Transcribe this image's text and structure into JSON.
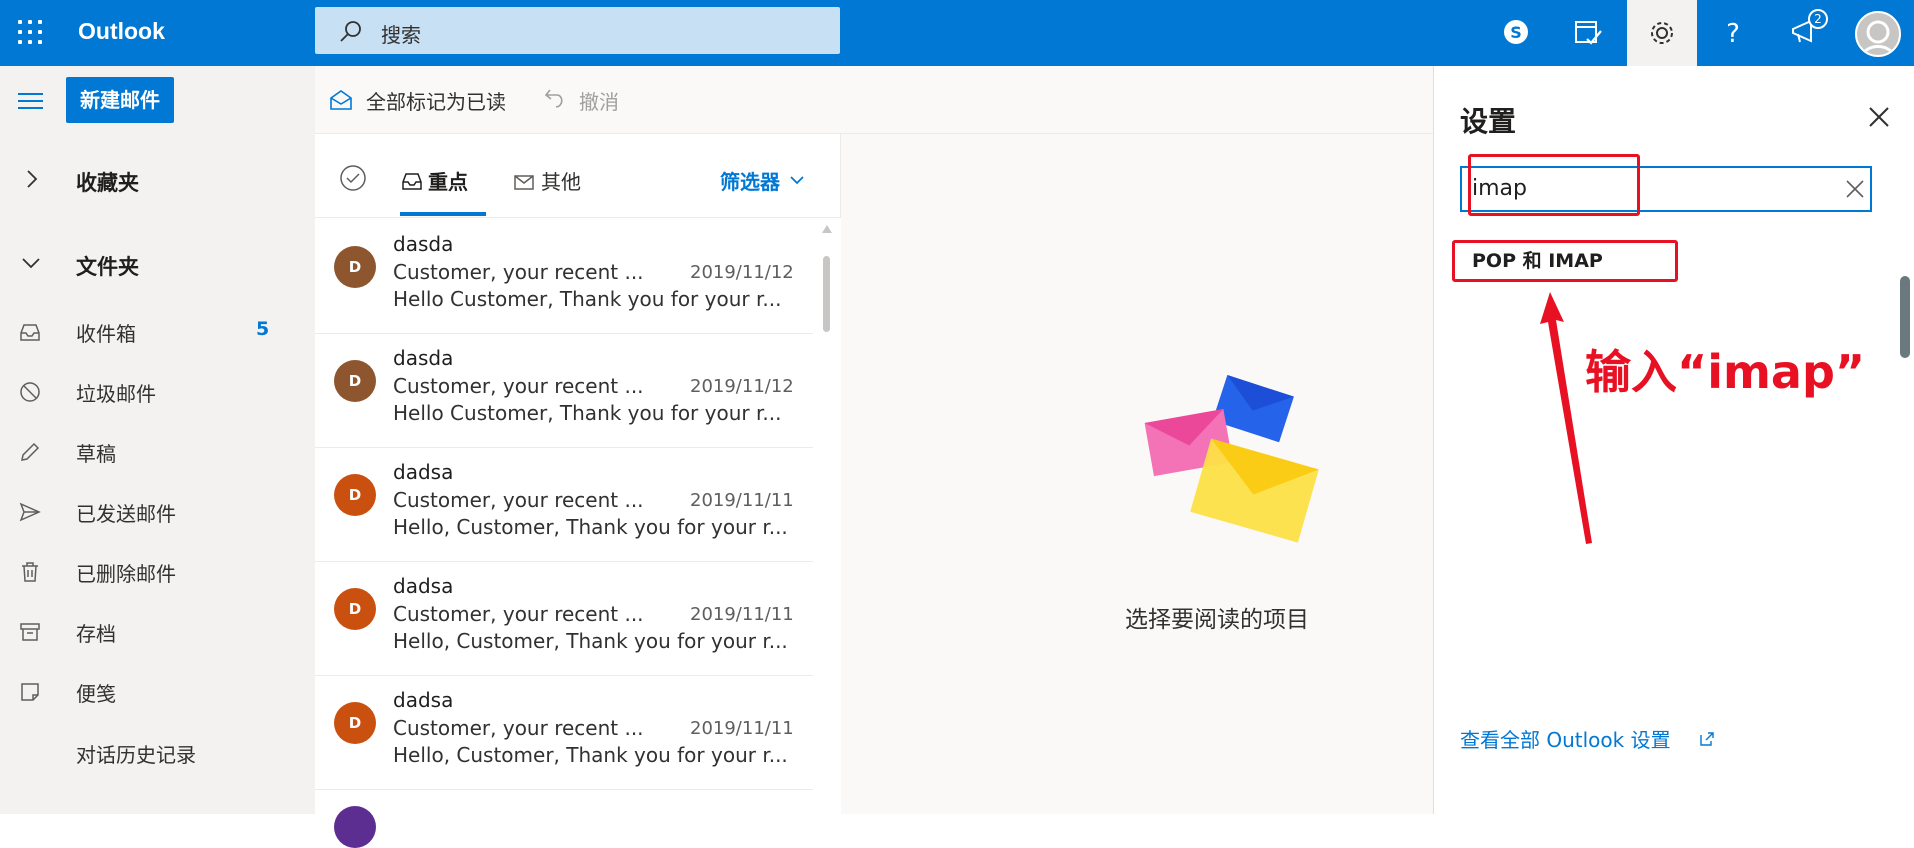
{
  "app": {
    "name": "Outlook"
  },
  "search": {
    "placeholder": "搜索"
  },
  "topbar": {
    "notification_count": "2"
  },
  "compose": {
    "new_mail_label": "新建邮件"
  },
  "toolbar": {
    "mark_all_read": "全部标记为已读",
    "undo": "撤消"
  },
  "nav": {
    "favorites": "收藏夹",
    "folders": "文件夹",
    "items": [
      {
        "label": "收件箱",
        "count": "5",
        "icon": "inbox-icon"
      },
      {
        "label": "垃圾邮件",
        "count": "",
        "icon": "junk-icon"
      },
      {
        "label": "草稿",
        "count": "",
        "icon": "pencil-icon"
      },
      {
        "label": "已发送邮件",
        "count": "",
        "icon": "send-icon"
      },
      {
        "label": "已删除邮件",
        "count": "",
        "icon": "trash-icon"
      },
      {
        "label": "存档",
        "count": "",
        "icon": "archive-icon"
      },
      {
        "label": "便笺",
        "count": "",
        "icon": "note-icon"
      },
      {
        "label": "对话历史记录",
        "count": "",
        "icon": ""
      }
    ]
  },
  "list": {
    "tabs": {
      "focused": "重点",
      "other": "其他"
    },
    "filter": "筛选器",
    "messages": [
      {
        "initial": "D",
        "from": "dasda",
        "subject": "Customer, your recent ...",
        "date": "2019/11/12",
        "preview": "Hello Customer, Thank you for your r...",
        "color": "#8e562e"
      },
      {
        "initial": "D",
        "from": "dasda",
        "subject": "Customer, your recent ...",
        "date": "2019/11/12",
        "preview": "Hello Customer, Thank you for your r...",
        "color": "#8e562e"
      },
      {
        "initial": "D",
        "from": "dadsa",
        "subject": "Customer, your recent ...",
        "date": "2019/11/11",
        "preview": "Hello, Customer, Thank you for your r...",
        "color": "#ca5010"
      },
      {
        "initial": "D",
        "from": "dadsa",
        "subject": "Customer, your recent ...",
        "date": "2019/11/11",
        "preview": "Hello, Customer, Thank you for your r...",
        "color": "#ca5010"
      },
      {
        "initial": "D",
        "from": "dadsa",
        "subject": "Customer, your recent ...",
        "date": "2019/11/11",
        "preview": "Hello, Customer, Thank you for your r...",
        "color": "#ca5010"
      }
    ]
  },
  "reading": {
    "empty_text": "选择要阅读的项目"
  },
  "settings": {
    "title": "设置",
    "search_value": "imap",
    "result": "POP 和 IMAP",
    "annotation": "输入“imap”",
    "view_all": "查看全部 Outlook 设置"
  },
  "colors": {
    "accent": "#0078d4",
    "annotation_red": "#e81123"
  }
}
